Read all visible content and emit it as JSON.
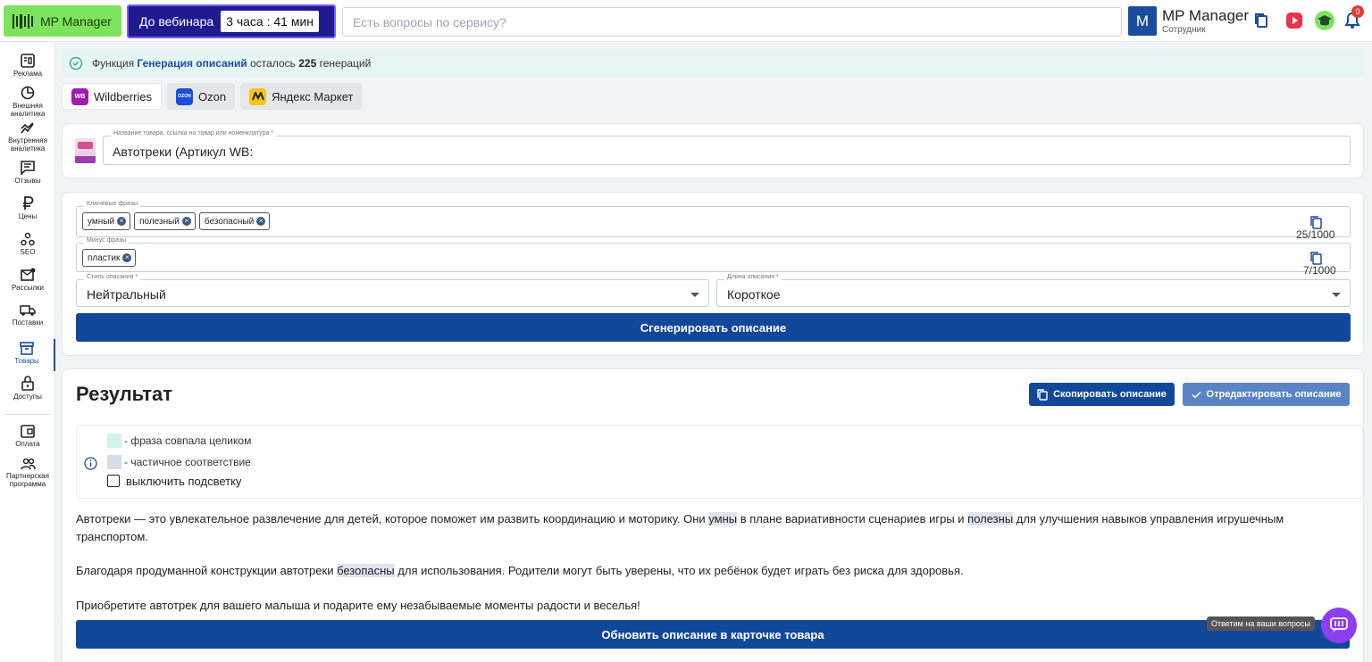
{
  "header": {
    "logo_text": "MP Manager",
    "webinar_label": "До вебинара",
    "webinar_timer": "3 часа : 41 мин",
    "search_placeholder": "Есть вопросы по сервису?",
    "user_initial": "M",
    "user_name": "MP Manager",
    "user_role": "Сотрудник",
    "notifications_count": "0"
  },
  "sidebar": {
    "items": [
      {
        "label": "Реклама",
        "icon": "ads-icon"
      },
      {
        "label": "Внешняя аналитика",
        "icon": "pie-chart-icon"
      },
      {
        "label": "Внутренняя аналитика",
        "icon": "trend-icon"
      },
      {
        "label": "Отзывы",
        "icon": "comment-icon"
      },
      {
        "label": "Цены",
        "icon": "ruble-icon"
      },
      {
        "label": "SEO",
        "icon": "seo-icon"
      },
      {
        "label": "Рассылки",
        "icon": "mail-icon"
      },
      {
        "label": "Поставки",
        "icon": "truck-icon"
      },
      {
        "label": "Товары",
        "icon": "box-icon"
      },
      {
        "label": "Доступы",
        "icon": "lock-icon"
      },
      {
        "label": "Оплата",
        "icon": "wallet-icon"
      },
      {
        "label": "Партнерская программа",
        "icon": "partners-icon"
      }
    ],
    "active": "Товары"
  },
  "alert": {
    "prefix": "Функция",
    "feature": "Генерация описаний",
    "middle": "осталось",
    "count": "225",
    "suffix": "генераций"
  },
  "marketplaces": [
    {
      "label": "Wildberries",
      "badge": "WB",
      "color": "#9b1fa8"
    },
    {
      "label": "Ozon",
      "badge": "OZON",
      "color": "#1d4ed8"
    },
    {
      "label": "Яндекс Маркет",
      "badge": "",
      "color": "#f5c518"
    }
  ],
  "product": {
    "label": "Название товара, ссылка на товар или номенклатура *",
    "value": "Автотреки (Артикул WB:"
  },
  "keywords": {
    "label": "Ключевые фразы",
    "chips": [
      "умный",
      "полезный",
      "безопасный"
    ],
    "counter": "25/1000"
  },
  "minus": {
    "label": "Минус фразы",
    "chips": [
      "пластик"
    ],
    "counter": "7/1000"
  },
  "style": {
    "label": "Стиль описания *",
    "value": "Нейтральный"
  },
  "length": {
    "label": "Длина описания *",
    "value": "Короткое"
  },
  "generate_button": "Сгенерировать описание",
  "result": {
    "title": "Результат",
    "copy_button": "Скопировать описание",
    "edit_button": "Отредактировать описание",
    "legend_full": "- фраза совпала целиком",
    "legend_partial": "- частичное соответствие",
    "legend_toggle": "выключить подсветку",
    "p1_a": "Автотреки — это увлекательное развлечение для детей, которое поможет им развить координацию и моторику. Они ",
    "p1_h1": "умны",
    "p1_b": " в плане вариативности сценариев игры и ",
    "p1_h2": "полезны",
    "p1_c": " для улучшения навыков управления игрушечным транспортом.",
    "p2_a": "Благодаря продуманной конструкции автотреки ",
    "p2_h": "безопасны",
    "p2_b": " для использования. Родители могут быть уверены, что их ребёнок будет играть без риска для здоровья.",
    "p3": "Приобретите автотрек для вашего малыша и подарите ему незабываемые моменты радости и веселья!",
    "update_button": "Обновить описание в карточке товара"
  },
  "help_tooltip": "Ответим на ваши вопросы",
  "colors": {
    "primary": "#12489a",
    "accent_green": "#7ee35c",
    "highlight_full": "#d2f3ea",
    "highlight_partial": "#dfe5ef"
  }
}
